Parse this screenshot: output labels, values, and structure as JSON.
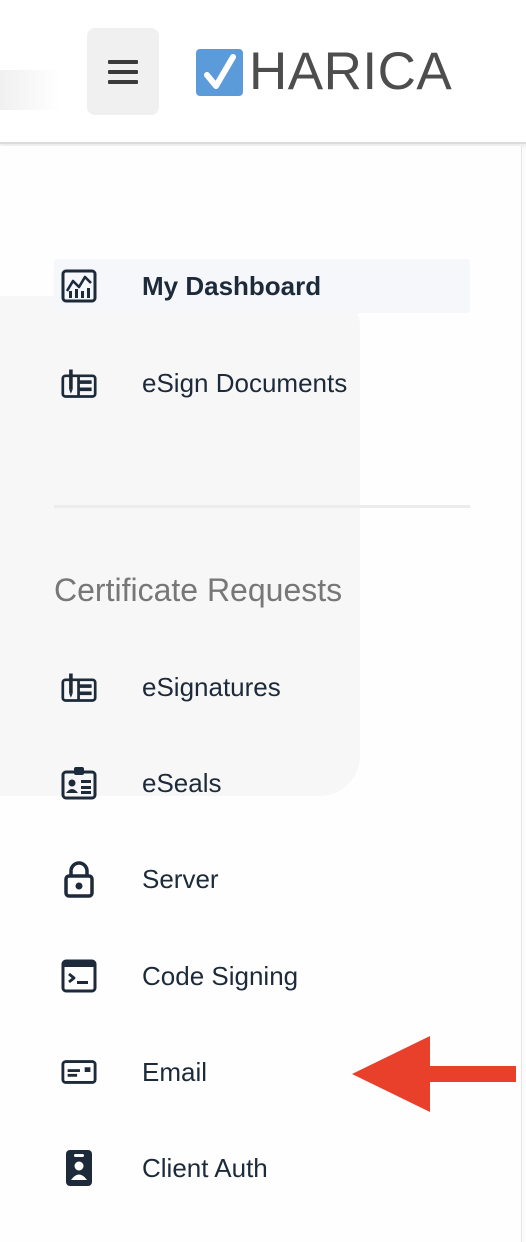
{
  "header": {
    "menu_icon": "hamburger-icon",
    "logo_text": "HARICA",
    "logo_check_color": "#5b9bd9"
  },
  "sidebar": {
    "top_items": [
      {
        "label": "My Dashboard",
        "icon": "dashboard-chart-icon",
        "active": true
      },
      {
        "label": "eSign Documents",
        "icon": "sign-document-icon",
        "active": false
      }
    ],
    "section_title": "Certificate Requests",
    "request_items": [
      {
        "label": "eSignatures",
        "icon": "signature-icon"
      },
      {
        "label": "eSeals",
        "icon": "id-card-icon"
      },
      {
        "label": "Server",
        "icon": "lock-icon"
      },
      {
        "label": "Code Signing",
        "icon": "terminal-icon"
      },
      {
        "label": "Email",
        "icon": "email-card-icon"
      },
      {
        "label": "Client Auth",
        "icon": "badge-icon"
      }
    ]
  },
  "annotation": {
    "arrow_color": "#e8402a",
    "arrow_target": "Email"
  }
}
